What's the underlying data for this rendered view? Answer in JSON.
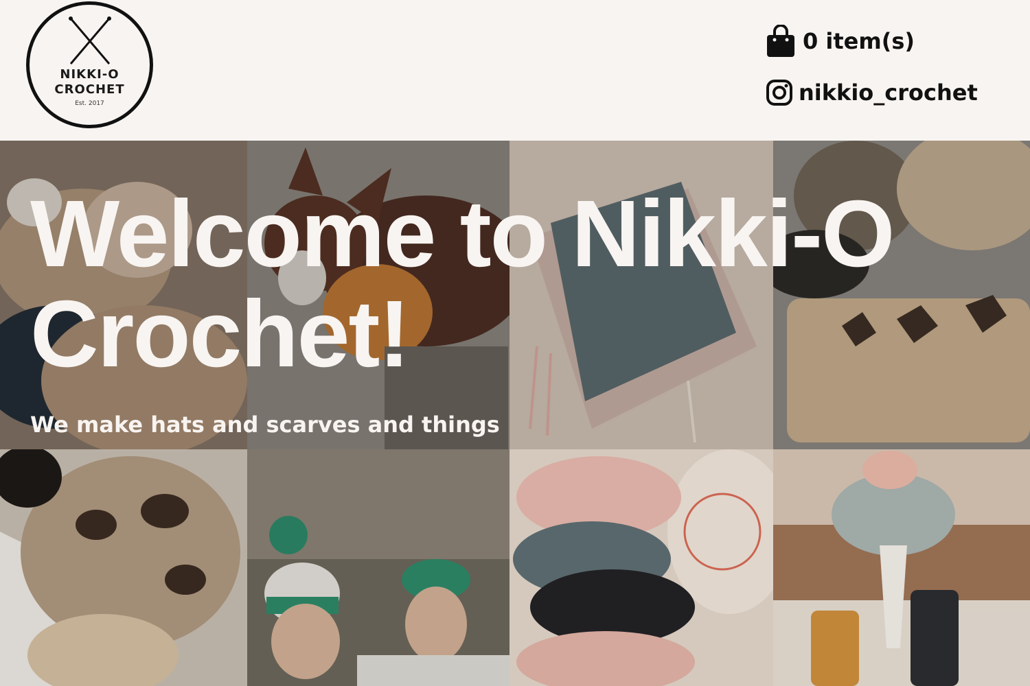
{
  "header": {
    "logo": {
      "line1": "NIKKI-O",
      "line2": "CROCHET",
      "line3": "Est. 2017"
    },
    "cart": {
      "icon": "shopping-bag-icon",
      "label": "0 item(s)"
    },
    "instagram": {
      "icon": "instagram-icon",
      "handle": "nikkio_crochet"
    }
  },
  "hero": {
    "title": "Welcome to Nikki-O Crochet!",
    "subtitle": "We make hats and scarves and things"
  },
  "gallery": {
    "tiles": [
      {
        "name": "cat-with-beanies-photo"
      },
      {
        "name": "dog-in-scarf-photo"
      },
      {
        "name": "grey-fringe-scarf-photo"
      },
      {
        "name": "beanie-with-yarn-photo"
      },
      {
        "name": "leopard-beanie-photo"
      },
      {
        "name": "two-girls-beanies-photo"
      },
      {
        "name": "scrunchies-photo"
      },
      {
        "name": "flowers-candles-photo"
      }
    ]
  },
  "colors": {
    "background": "#f8f4f1",
    "text_dark": "#111111",
    "hero_text": "#f8f4f1"
  }
}
